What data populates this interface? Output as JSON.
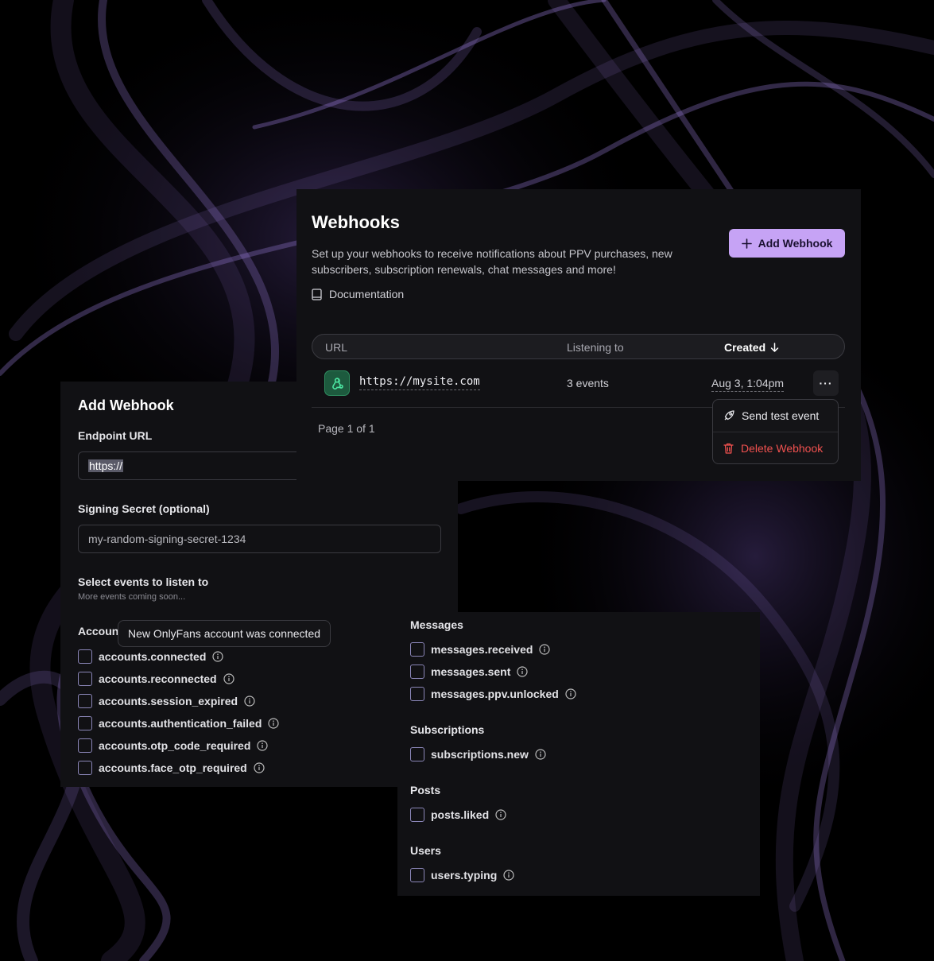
{
  "add_form": {
    "title": "Add Webhook",
    "endpoint_label": "Endpoint URL",
    "endpoint_value": "https://",
    "secret_label": "Signing Secret (optional)",
    "secret_value": "my-random-signing-secret-1234",
    "events_label": "Select events to listen to",
    "events_sublabel": "More events coming soon...",
    "group_accounts": "Accoun",
    "tooltip": "New OnlyFans account was connected",
    "account_events": [
      "accounts.connected",
      "accounts.reconnected",
      "accounts.session_expired",
      "accounts.authentication_failed",
      "accounts.otp_code_required",
      "accounts.face_otp_required"
    ]
  },
  "webhooks": {
    "title": "Webhooks",
    "description": "Set up your webhooks to receive notifications about PPV purchases, new subscribers, subscription renewals, chat messages and more!",
    "add_button": "Add Webhook",
    "documentation": "Documentation",
    "columns": {
      "url": "URL",
      "listening": "Listening to",
      "created": "Created"
    },
    "row": {
      "url": "https://mysite.com",
      "events": "3 events",
      "created": "Aug 3, 1:04pm"
    },
    "pagination": "Page 1 of 1",
    "menu": {
      "send_test": "Send test event",
      "delete": "Delete Webhook"
    }
  },
  "event_groups": {
    "messages_title": "Messages",
    "messages": [
      "messages.received",
      "messages.sent",
      "messages.ppv.unlocked"
    ],
    "subscriptions_title": "Subscriptions",
    "subscriptions": [
      "subscriptions.new"
    ],
    "posts_title": "Posts",
    "posts": [
      "posts.liked"
    ],
    "users_title": "Users",
    "users": [
      "users.typing"
    ]
  },
  "colors": {
    "accent": "#c6a3f5",
    "danger": "#f0514f",
    "background": "#000000",
    "panel": "#111114"
  }
}
